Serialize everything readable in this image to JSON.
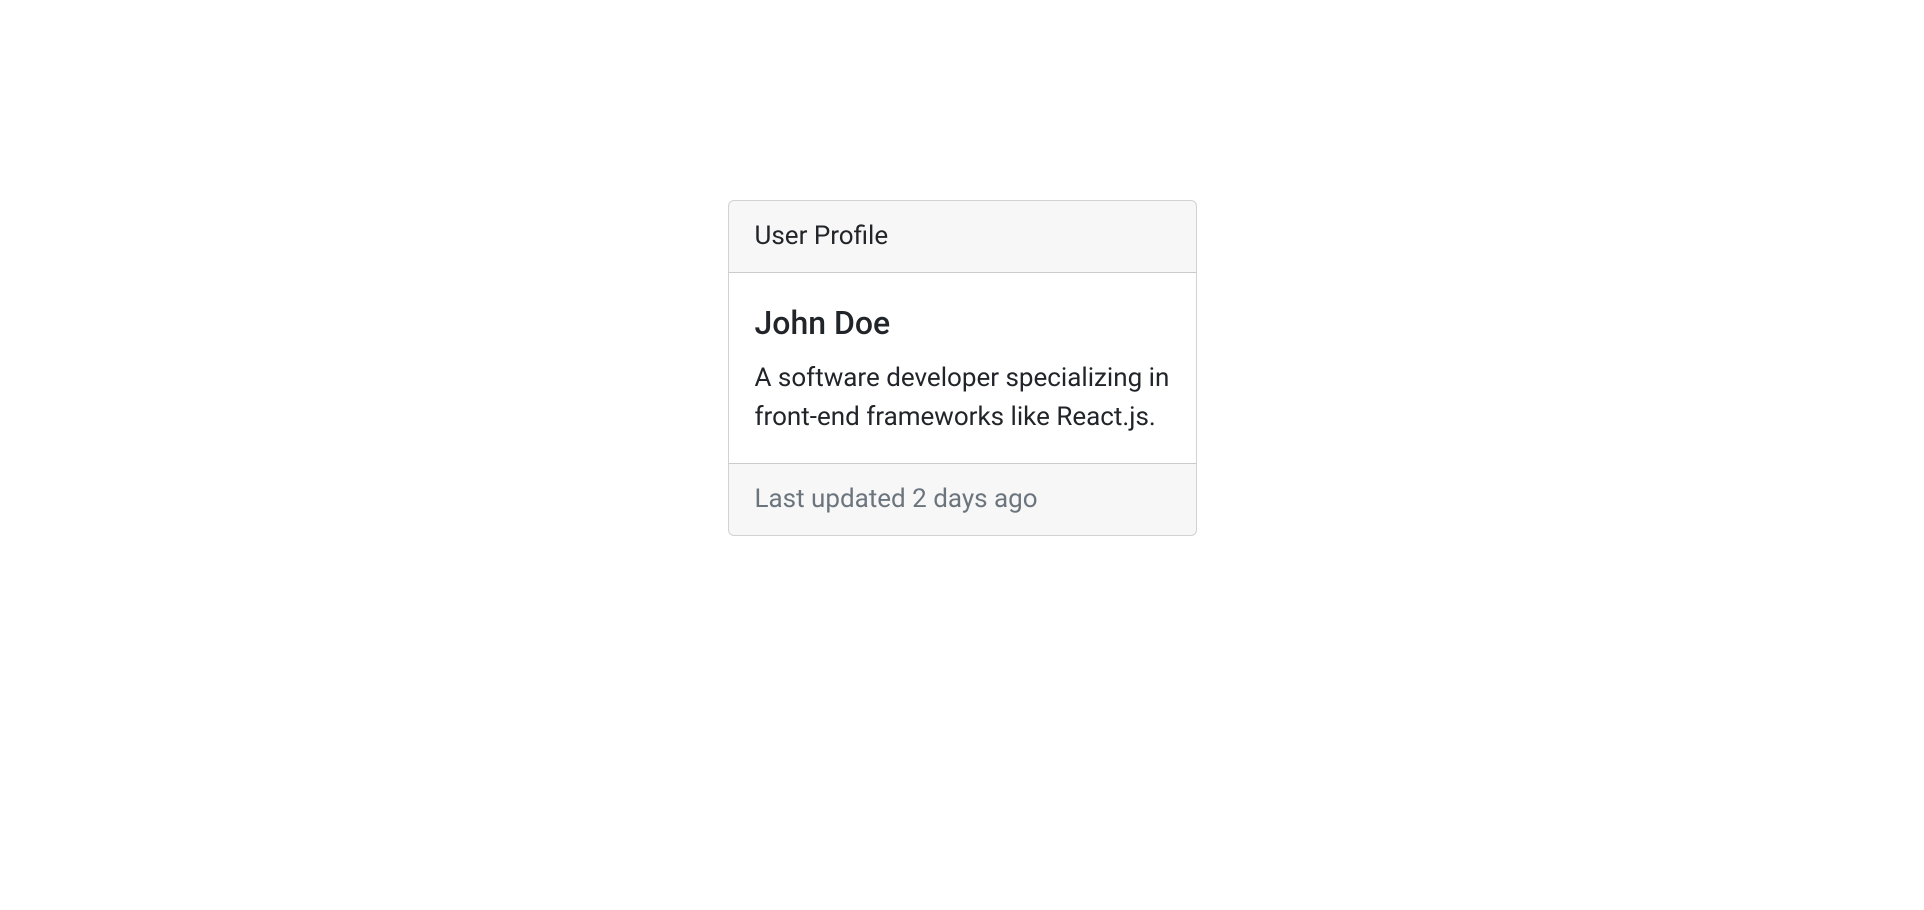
{
  "card": {
    "header": "User Profile",
    "title": "John Doe",
    "text": "A software developer specializing in front-end frameworks like React.js.",
    "footer": "Last updated 2 days ago"
  }
}
